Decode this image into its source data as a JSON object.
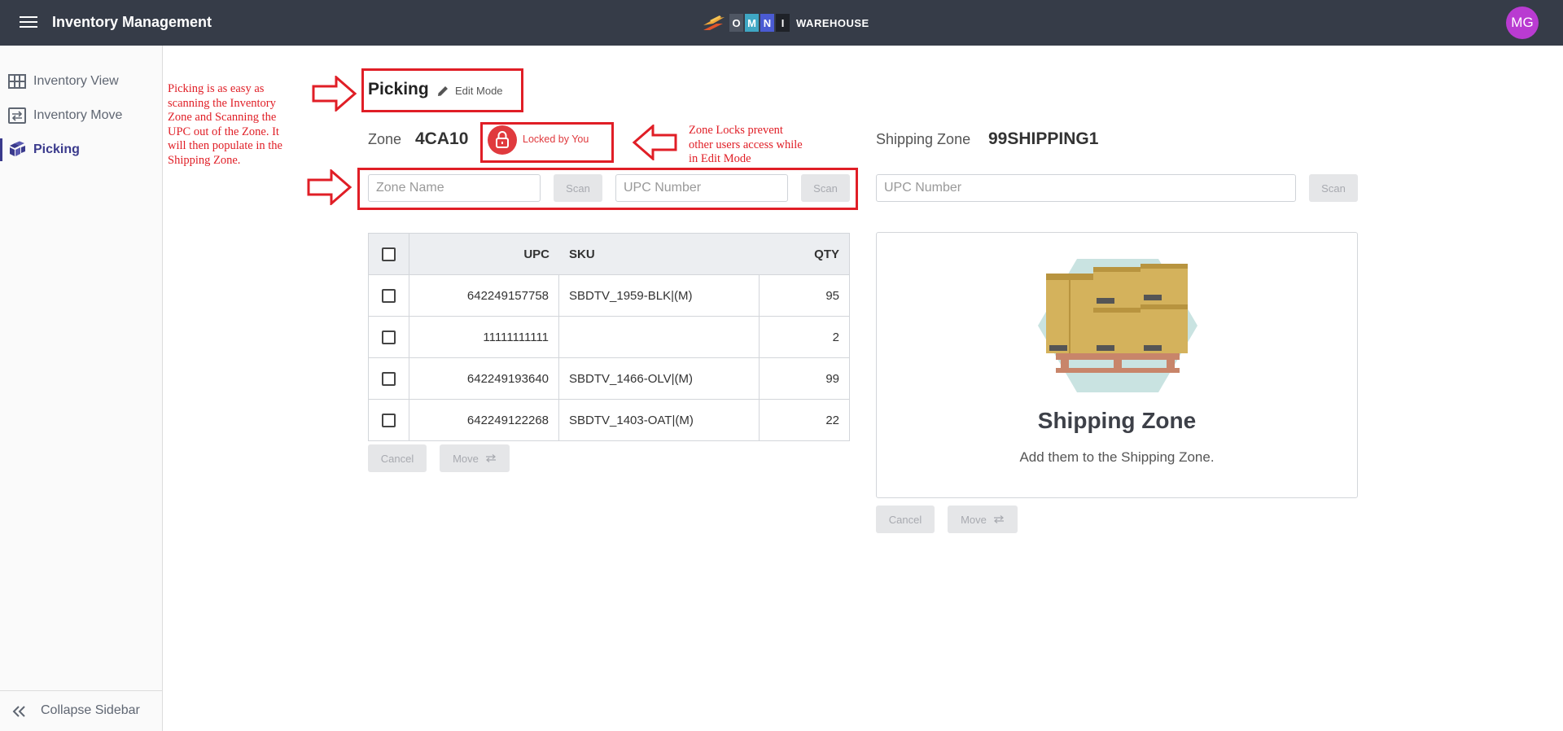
{
  "header": {
    "title": "Inventory Management",
    "logo_letters": [
      "O",
      "M",
      "N",
      "I"
    ],
    "logo_word": "WAREHOUSE",
    "avatar_initials": "MG",
    "colors": {
      "bar": "#363c48",
      "avatar": "#b93bd1"
    }
  },
  "sidebar": {
    "items": [
      {
        "label": "Inventory View",
        "icon": "grid-icon"
      },
      {
        "label": "Inventory Move",
        "icon": "transfer-icon"
      },
      {
        "label": "Picking",
        "icon": "boxes-icon",
        "active": true
      }
    ],
    "collapse_label": "Collapse Sidebar"
  },
  "annotations": {
    "picking_note": "Picking is as easy as scanning the Inventory Zone and Scanning the UPC out of the Zone. It will then populate in the Shipping Zone.",
    "lock_note": "Zone Locks prevent other users access while in Edit Mode"
  },
  "picking": {
    "title": "Picking",
    "edit_mode": "Edit Mode",
    "zone_label": "Zone",
    "zone_value": "4CA10",
    "lock_label": "Locked by You",
    "zone_placeholder": "Zone Name",
    "upc_placeholder": "UPC Number",
    "scan_label": "Scan",
    "table": {
      "headers": {
        "upc": "UPC",
        "sku": "SKU",
        "qty": "QTY"
      },
      "rows": [
        {
          "upc": "642249157758",
          "sku": "SBDTV_1959-BLK|(M)",
          "qty": "95"
        },
        {
          "upc": "11111111111",
          "sku": "",
          "qty": "2"
        },
        {
          "upc": "642249193640",
          "sku": "SBDTV_1466-OLV|(M)",
          "qty": "99"
        },
        {
          "upc": "642249122268",
          "sku": "SBDTV_1403-OAT|(M)",
          "qty": "22"
        }
      ]
    },
    "cancel_label": "Cancel",
    "move_label": "Move"
  },
  "shipping": {
    "label": "Shipping Zone",
    "value": "99SHIPPING1",
    "upc_placeholder": "UPC Number",
    "scan_label": "Scan",
    "card_title": "Shipping Zone",
    "card_subtitle": "Add them to the Shipping Zone.",
    "cancel_label": "Cancel",
    "move_label": "Move"
  }
}
